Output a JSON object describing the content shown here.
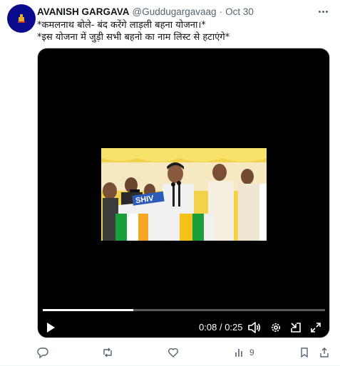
{
  "author": {
    "name": "AVANISH GARGAVA",
    "handle": "@Guddugargavaag",
    "separator": "·",
    "time": "Oct 30",
    "avatar_bg": "#0a0a8c"
  },
  "tweet": {
    "line1": "*कमलनाथ बोले- बंद करेंगे लाड़ली बहना योजना।*",
    "line2": "*इस योजना में जुड़ी सभी बहनो का नाम लिस्ट से हटाएंगे*"
  },
  "video": {
    "current_time": "0:08",
    "time_separator": "/",
    "duration": "0:25",
    "progress_fraction": 0.32,
    "banner_text": "SHIV",
    "controls": [
      "play-icon",
      "volume-icon",
      "settings-icon",
      "pip-icon",
      "fullscreen-icon"
    ]
  },
  "actions": {
    "reply_count": "",
    "retweet_count": "",
    "like_count": "",
    "views_count": "9",
    "icons": [
      "reply-icon",
      "retweet-icon",
      "like-icon",
      "views-icon",
      "bookmark-icon",
      "share-icon"
    ]
  },
  "colors": {
    "text_primary": "#0f1419",
    "text_secondary": "#536471",
    "video_bg": "#000000"
  }
}
